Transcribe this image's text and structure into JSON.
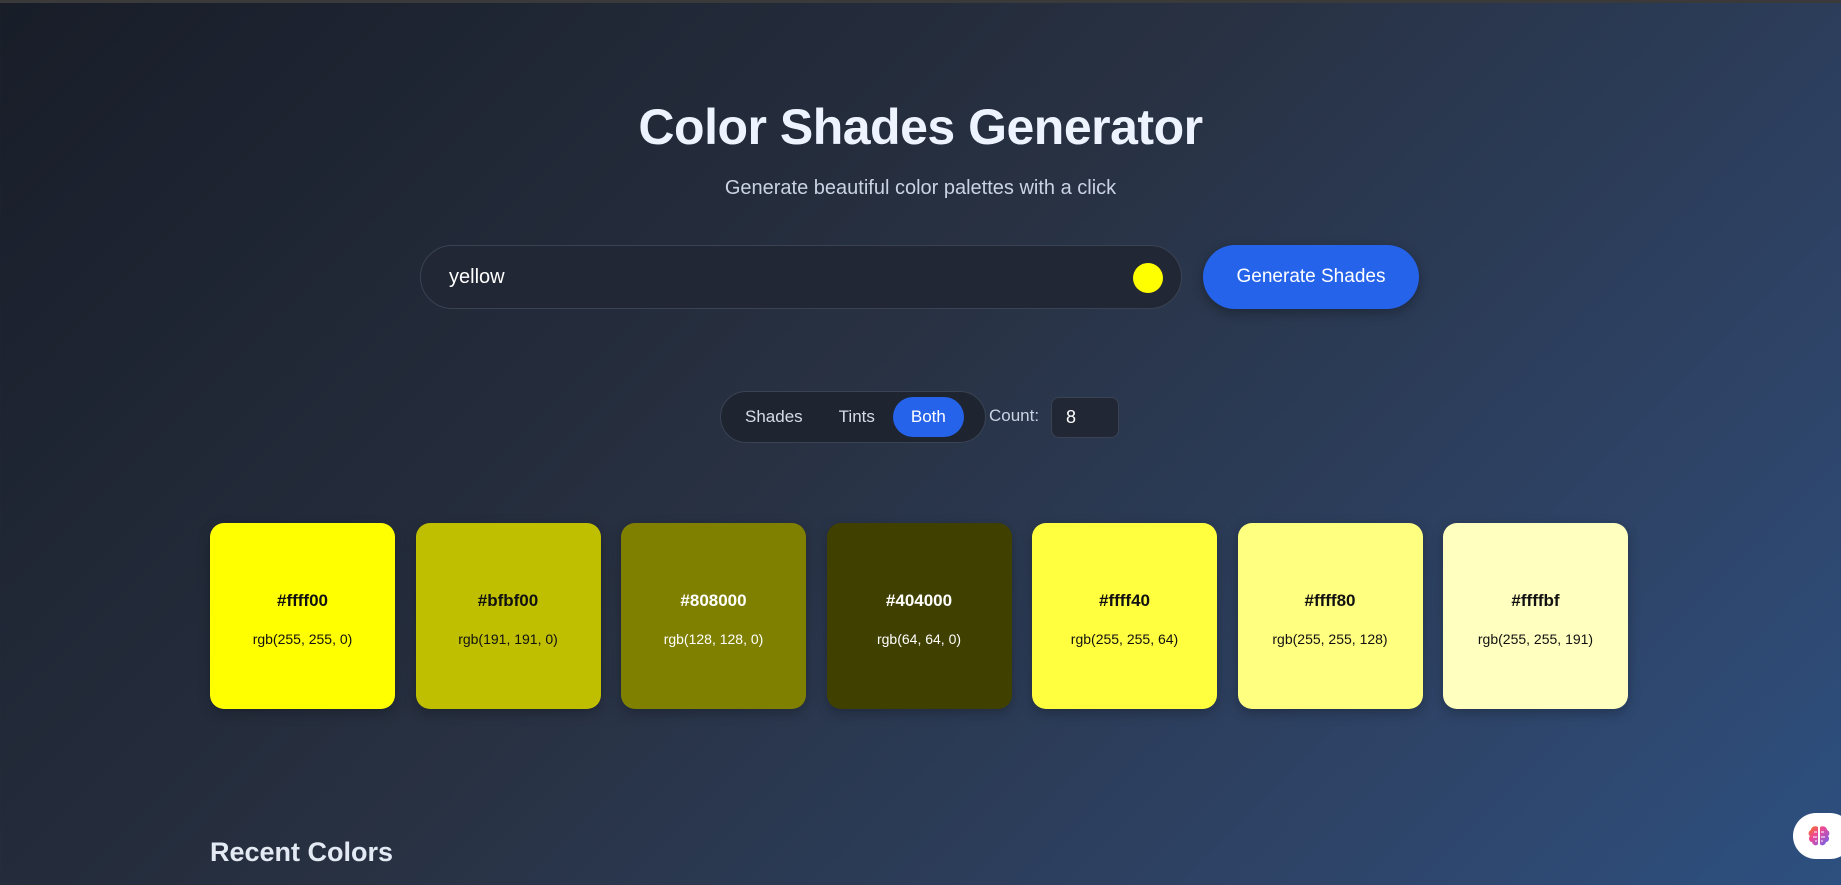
{
  "header": {
    "title": "Color Shades Generator",
    "subtitle": "Generate beautiful color palettes with a click"
  },
  "input": {
    "value": "yellow",
    "swatch_color": "#ffff00"
  },
  "generate_label": "Generate Shades",
  "modes": {
    "items": [
      "Shades",
      "Tints",
      "Both"
    ],
    "active": "Both"
  },
  "count": {
    "label": "Count:",
    "value": "8"
  },
  "cards": [
    {
      "hex": "#ffff00",
      "rgb": "rgb(255, 255, 0)",
      "bg": "#ffff00",
      "fg": "#111111"
    },
    {
      "hex": "#bfbf00",
      "rgb": "rgb(191, 191, 0)",
      "bg": "#bfbf00",
      "fg": "#111111"
    },
    {
      "hex": "#808000",
      "rgb": "rgb(128, 128, 0)",
      "bg": "#808000",
      "fg": "#ffffff"
    },
    {
      "hex": "#404000",
      "rgb": "rgb(64, 64, 0)",
      "bg": "#404000",
      "fg": "#ffffff"
    },
    {
      "hex": "#ffff40",
      "rgb": "rgb(255, 255, 64)",
      "bg": "#ffff40",
      "fg": "#111111"
    },
    {
      "hex": "#ffff80",
      "rgb": "rgb(255, 255, 128)",
      "bg": "#ffff80",
      "fg": "#111111"
    },
    {
      "hex": "#ffffbf",
      "rgb": "rgb(255, 255, 191)",
      "bg": "#ffffbf",
      "fg": "#111111"
    }
  ],
  "recent_title": "Recent Colors",
  "accent": "#2563eb",
  "assistant_icon": "brain-icon"
}
